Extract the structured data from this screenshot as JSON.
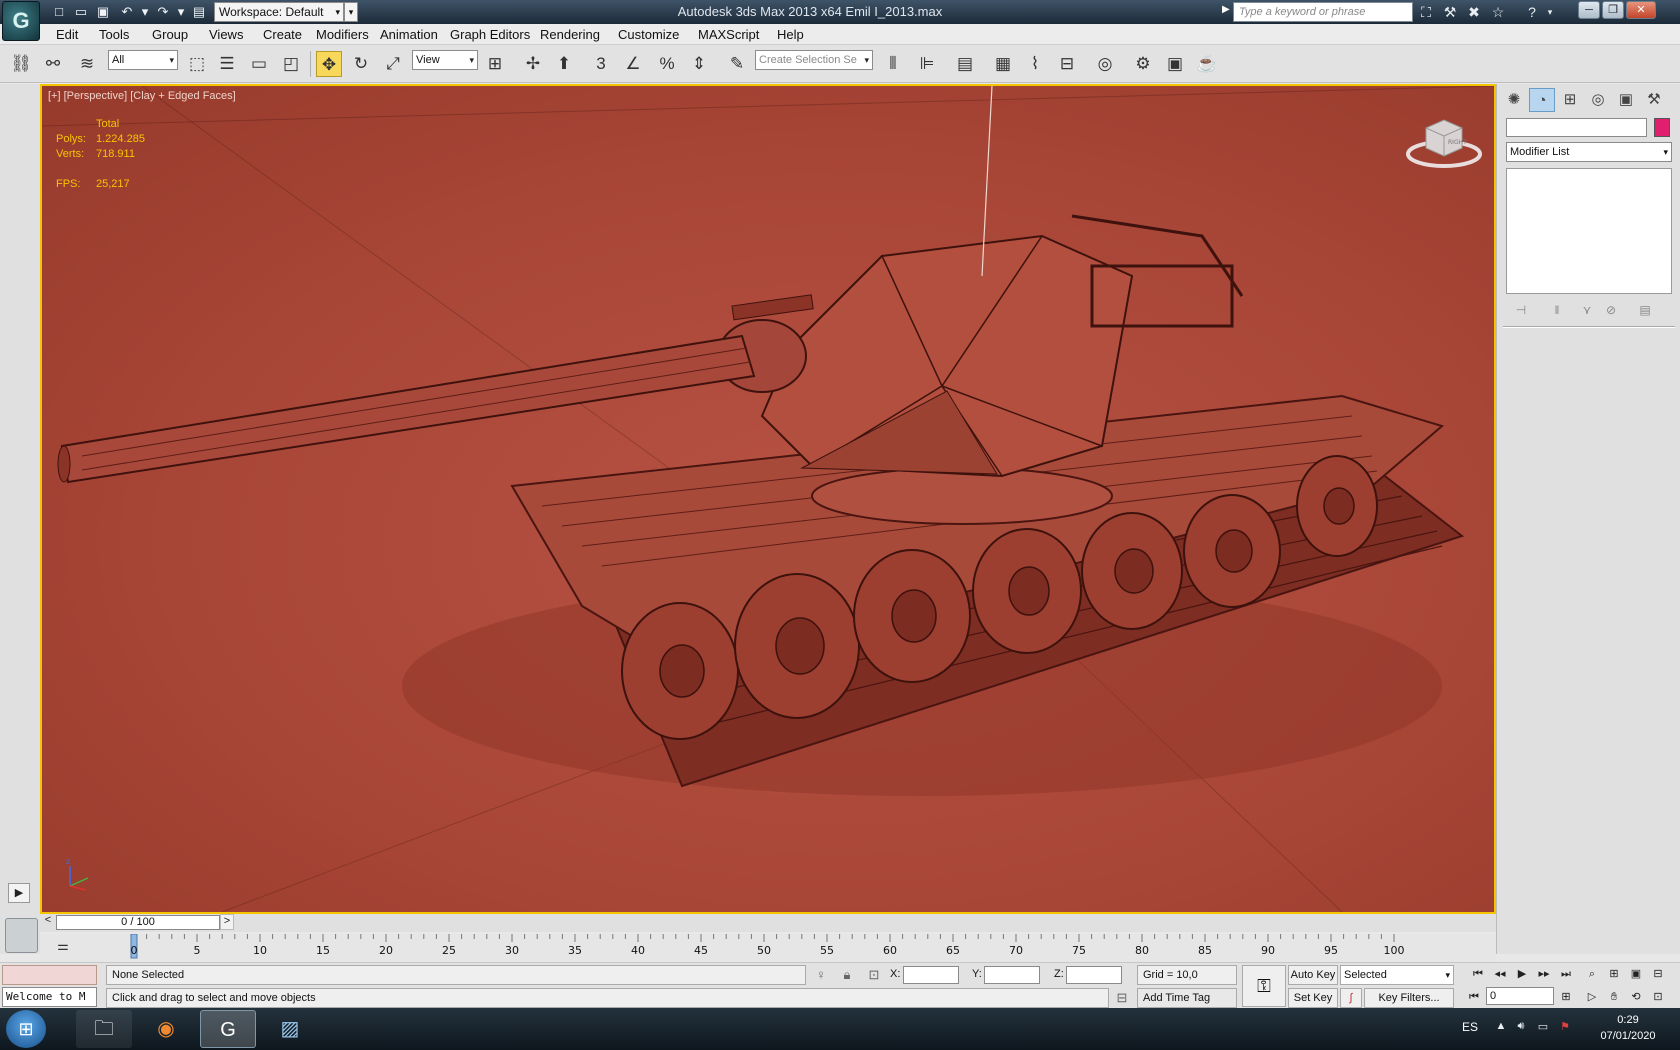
{
  "titlebar": {
    "workspace": "Workspace: Default",
    "title": "Autodesk 3ds Max  2013 x64      Emil I_2013.max",
    "search_placeholder": "Type a keyword or phrase"
  },
  "menu": [
    "Edit",
    "Tools",
    "Group",
    "Views",
    "Create",
    "Modifiers",
    "Animation",
    "Graph Editors",
    "Rendering",
    "Customize",
    "MAXScript",
    "Help"
  ],
  "toolbar": {
    "filter": "All",
    "refcoord": "View",
    "selection_set": "Create Selection Se"
  },
  "viewport": {
    "label": "[+] [Perspective] [Clay + Edged Faces]",
    "stats": {
      "header": "Total",
      "polys_label": "Polys:",
      "polys": "1.224.285",
      "verts_label": "Verts:",
      "verts": "718.911",
      "fps_label": "FPS:",
      "fps": "25,217"
    },
    "viewcube_face": "RIGHT",
    "axis_z": "z"
  },
  "timeline": {
    "slider": "0 / 100",
    "tick_labels": [
      "0",
      "5",
      "10",
      "15",
      "20",
      "25",
      "30",
      "35",
      "40",
      "45",
      "50",
      "55",
      "60",
      "65",
      "70",
      "75",
      "80",
      "85",
      "90",
      "95",
      "100"
    ]
  },
  "status": {
    "listener": "Welcome to M",
    "selection": "None Selected",
    "prompt": "Click and drag to select and move objects",
    "x_label": "X:",
    "y_label": "Y:",
    "z_label": "Z:",
    "grid": "Grid = 10,0",
    "add_time_tag": "Add Time Tag",
    "auto_key": "Auto Key",
    "set_key": "Set Key",
    "key_mode": "Selected",
    "key_filters": "Key Filters...",
    "frame": "0"
  },
  "command_panel": {
    "modifier_list": "Modifier List",
    "swatch_color": "#e0206f"
  },
  "taskbar": {
    "lang": "ES",
    "time": "0:29",
    "date": "07/01/2020"
  },
  "colors": {
    "viewport_bg": "#a74536",
    "viewport_border": "#f5c400",
    "stats_text": "#f9c400"
  }
}
